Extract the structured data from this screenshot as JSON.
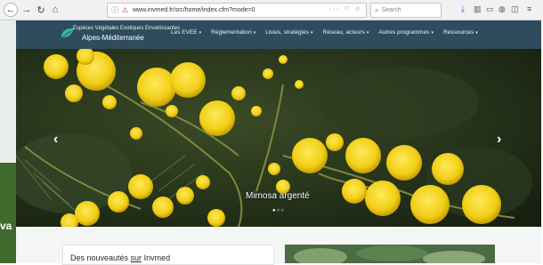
{
  "browser": {
    "url": "www.invmed.fr/src/home/index.cfm?mode=0",
    "search_placeholder": "Search"
  },
  "site": {
    "brand_line1": "Espèces Végétales Exotiques Envahissantes",
    "brand_line2": "Alpes-Méditerranée",
    "nav": [
      {
        "label": "Les EVEE"
      },
      {
        "label": "Réglementation"
      },
      {
        "label": "Listes, stratégies"
      },
      {
        "label": "Réseau, acteurs"
      },
      {
        "label": "Autres programmes"
      },
      {
        "label": "Ressources"
      }
    ]
  },
  "hero": {
    "caption": "Mimosa argenté",
    "slides_count": 3,
    "active_slide": 1
  },
  "news": {
    "title_prefix": "Des nouveautés ",
    "title_link": "sur",
    "title_suffix": " Invmed"
  },
  "left_strip_text": "va",
  "colors": {
    "header_bg": "#2f4c5e",
    "mimosa": "#f3d21c"
  }
}
